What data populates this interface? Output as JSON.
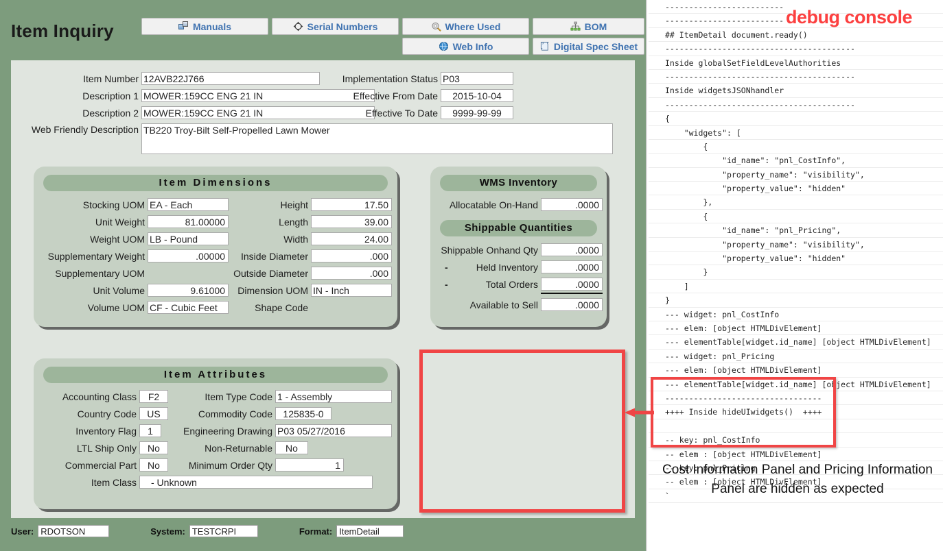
{
  "app": {
    "title": "Item Inquiry",
    "tabs": [
      {
        "label": "Manuals",
        "icon": "manuals-icon"
      },
      {
        "label": "Serial Numbers",
        "icon": "crosshair-icon"
      },
      {
        "label": "Where Used",
        "icon": "gear-pencil-icon"
      },
      {
        "label": "BOM",
        "icon": "hierarchy-icon"
      },
      {
        "label": "Web Info",
        "icon": "globe-icon"
      },
      {
        "label": "Digital Spec Sheet",
        "icon": "document-icon"
      }
    ]
  },
  "header_fields": {
    "item_number": {
      "label": "Item Number",
      "value": "12AVB22J766"
    },
    "description1": {
      "label": "Description 1",
      "value": "MOWER:159CC ENG 21 IN"
    },
    "description2": {
      "label": "Description 2",
      "value": "MOWER:159CC ENG 21 IN"
    },
    "web_friendly": {
      "label": "Web Friendly Description",
      "value": "TB220  Troy-Bilt Self-Propelled Lawn Mower"
    },
    "impl_status": {
      "label": "Implementation Status",
      "value": "P03"
    },
    "eff_from": {
      "label": "Effective From Date",
      "value": "2015-10-04"
    },
    "eff_to": {
      "label": "Effective To Date",
      "value": "9999-99-99"
    }
  },
  "item_dimensions": {
    "title": "Item Dimensions",
    "left": [
      {
        "label": "Stocking UOM",
        "value": "EA - Each",
        "align": "left"
      },
      {
        "label": "Unit Weight",
        "value": "81.00000",
        "align": "right"
      },
      {
        "label": "Weight UOM",
        "value": "LB - Pound",
        "align": "left"
      },
      {
        "label": "Supplementary Weight",
        "value": ".00000",
        "align": "right"
      },
      {
        "label": "Supplementary UOM",
        "value": "",
        "align": "left"
      },
      {
        "label": "Unit Volume",
        "value": "9.61000",
        "align": "right"
      },
      {
        "label": "Volume UOM",
        "value": "CF - Cubic Feet",
        "align": "left"
      }
    ],
    "right": [
      {
        "label": "Height",
        "value": "17.50",
        "align": "right"
      },
      {
        "label": "Length",
        "value": "39.00",
        "align": "right"
      },
      {
        "label": "Width",
        "value": "24.00",
        "align": "right"
      },
      {
        "label": "Inside Diameter",
        "value": ".000",
        "align": "right"
      },
      {
        "label": "Outside Diameter",
        "value": ".000",
        "align": "right"
      },
      {
        "label": "Dimension UOM",
        "value": "IN - Inch",
        "align": "left"
      },
      {
        "label": "Shape Code",
        "value": "",
        "align": "left"
      }
    ]
  },
  "wms_inventory": {
    "title": "WMS Inventory",
    "allocatable": {
      "label": "Allocatable On-Hand",
      "value": ".0000"
    },
    "shippable_title": "Shippable Quantities",
    "rows": [
      {
        "prefix": "",
        "label": "Shippable Onhand Qty",
        "value": ".0000"
      },
      {
        "prefix": "-",
        "label": "Held Inventory",
        "value": ".0000"
      },
      {
        "prefix": "-",
        "label": "Total Orders",
        "value": ".0000"
      },
      {
        "prefix": "",
        "label": "Available to Sell",
        "value": ".0000"
      }
    ]
  },
  "item_attributes": {
    "title": "Item Attributes",
    "left": [
      {
        "label": "Accounting Class",
        "value": "F2"
      },
      {
        "label": "Country Code",
        "value": "US"
      },
      {
        "label": "Inventory Flag",
        "value": "1"
      },
      {
        "label": "LTL Ship Only",
        "value": "No"
      },
      {
        "label": "Commercial Part",
        "value": "No"
      }
    ],
    "right": [
      {
        "label": "Item Type Code",
        "value": "1 - Assembly"
      },
      {
        "label": "Commodity Code",
        "value": "125835-0"
      },
      {
        "label": "Engineering Drawing",
        "value": "P03  05/27/2016"
      },
      {
        "label": "Non-Returnable",
        "value": "No"
      },
      {
        "label": "Minimum Order Qty",
        "value": "1"
      }
    ],
    "item_class": {
      "label": "Item Class",
      "value": "  - Unknown"
    }
  },
  "footer": {
    "user_label": "User:",
    "user_value": "RDOTSON",
    "system_label": "System:",
    "system_value": "TESTCRPI",
    "format_label": "Format:",
    "format_value": "ItemDetail"
  },
  "console": {
    "title": "debug console",
    "caption": "Cost Information Panel and Pricing Information Panel are hidden as expected",
    "lines": [
      "-------------------------",
      "-------------------------",
      "## ItemDetail document.ready()",
      "----------------------------------------",
      "Inside globalSetFieldLevelAuthorities",
      "----------------------------------------",
      "Inside widgetsJSONhandler",
      "----------------------------------------",
      "{",
      "    \"widgets\": [",
      "        {",
      "            \"id_name\": \"pnl_CostInfo\",",
      "            \"property_name\": \"visibility\",",
      "            \"property_value\": \"hidden\"",
      "        },",
      "        {",
      "            \"id_name\": \"pnl_Pricing\",",
      "            \"property_name\": \"visibility\",",
      "            \"property_value\": \"hidden\"",
      "        }",
      "    ]",
      "}",
      "--- widget: pnl_CostInfo",
      "--- elem: [object HTMLDivElement]",
      "--- elementTable[widget.id_name] [object HTMLDivElement]",
      "--- widget: pnl_Pricing",
      "--- elem: [object HTMLDivElement]",
      "--- elementTable[widget.id_name] [object HTMLDivElement]",
      "---------------------------------",
      "++++ Inside hideUIwidgets()  ++++",
      "",
      "-- key: pnl_CostInfo",
      "-- elem : [object HTMLDivElement]",
      "-- key: pnl_Pricing",
      "-- elem : [object HTMLDivElement]",
      "`"
    ]
  },
  "colors": {
    "header_band": "#7d9c7d",
    "form_bg": "#e0e5df",
    "panel_bg": "#c6d1c4",
    "panel_title_bg": "#9db59b",
    "accent_red": "#f04545",
    "link_blue": "#3f72b0"
  }
}
